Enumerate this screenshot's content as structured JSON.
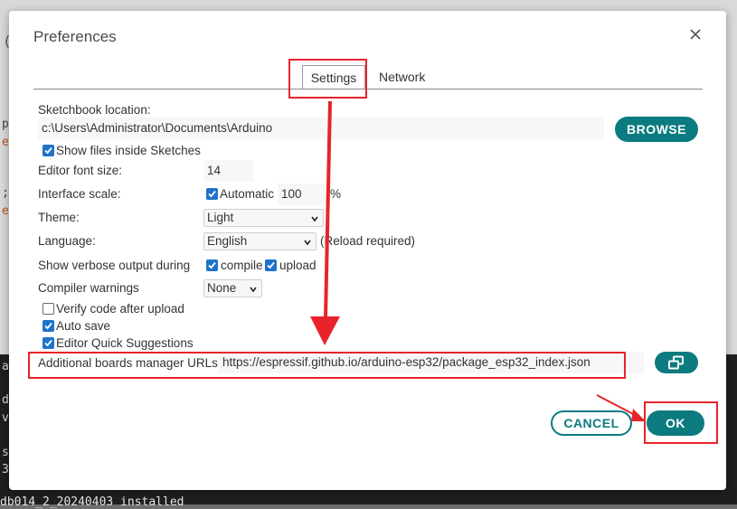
{
  "background": {
    "left_glyphs": [
      "(",
      "p",
      "e",
      ";",
      "e",
      "a",
      "d",
      "v",
      "s",
      "3"
    ],
    "status_line": "db014_2_20240403 installed"
  },
  "dialog": {
    "title": "Preferences",
    "tabs": [
      {
        "label": "Settings",
        "active": true
      },
      {
        "label": "Network",
        "active": false
      }
    ],
    "sketchbook": {
      "label": "Sketchbook location:",
      "value": "c:\\Users\\Administrator\\Documents\\Arduino",
      "browse_label": "BROWSE",
      "show_files_label": "Show files inside Sketches",
      "show_files_checked": true
    },
    "font_size": {
      "label": "Editor font size:",
      "value": "14"
    },
    "interface_scale": {
      "label": "Interface scale:",
      "automatic_label": "Automatic",
      "automatic_checked": true,
      "value": "100",
      "unit": "%"
    },
    "theme": {
      "label": "Theme:",
      "value": "Light"
    },
    "language": {
      "label": "Language:",
      "value": "English",
      "note": "(Reload required)"
    },
    "verbose": {
      "label": "Show verbose output during",
      "compile_label": "compile",
      "compile_checked": true,
      "upload_label": "upload",
      "upload_checked": true
    },
    "compiler_warnings": {
      "label": "Compiler warnings",
      "value": "None"
    },
    "verify_after_upload": {
      "label": "Verify code after upload",
      "checked": false
    },
    "auto_save": {
      "label": "Auto save",
      "checked": true
    },
    "quick_suggestions": {
      "label": "Editor Quick Suggestions",
      "checked": true
    },
    "boards_urls": {
      "label": "Additional boards manager URLs:",
      "value": "https://espressif.github.io/arduino-esp32/package_esp32_index.json"
    },
    "cancel_label": "CANCEL",
    "ok_label": "OK"
  },
  "colors": {
    "accent": "#0b7b80",
    "checkbox": "#1e73c9",
    "annotation": "#e8232b"
  },
  "icons": [
    "close-icon",
    "chevron-down-icon",
    "checkmark-icon",
    "external-window-icon",
    "annotation-arrow"
  ]
}
